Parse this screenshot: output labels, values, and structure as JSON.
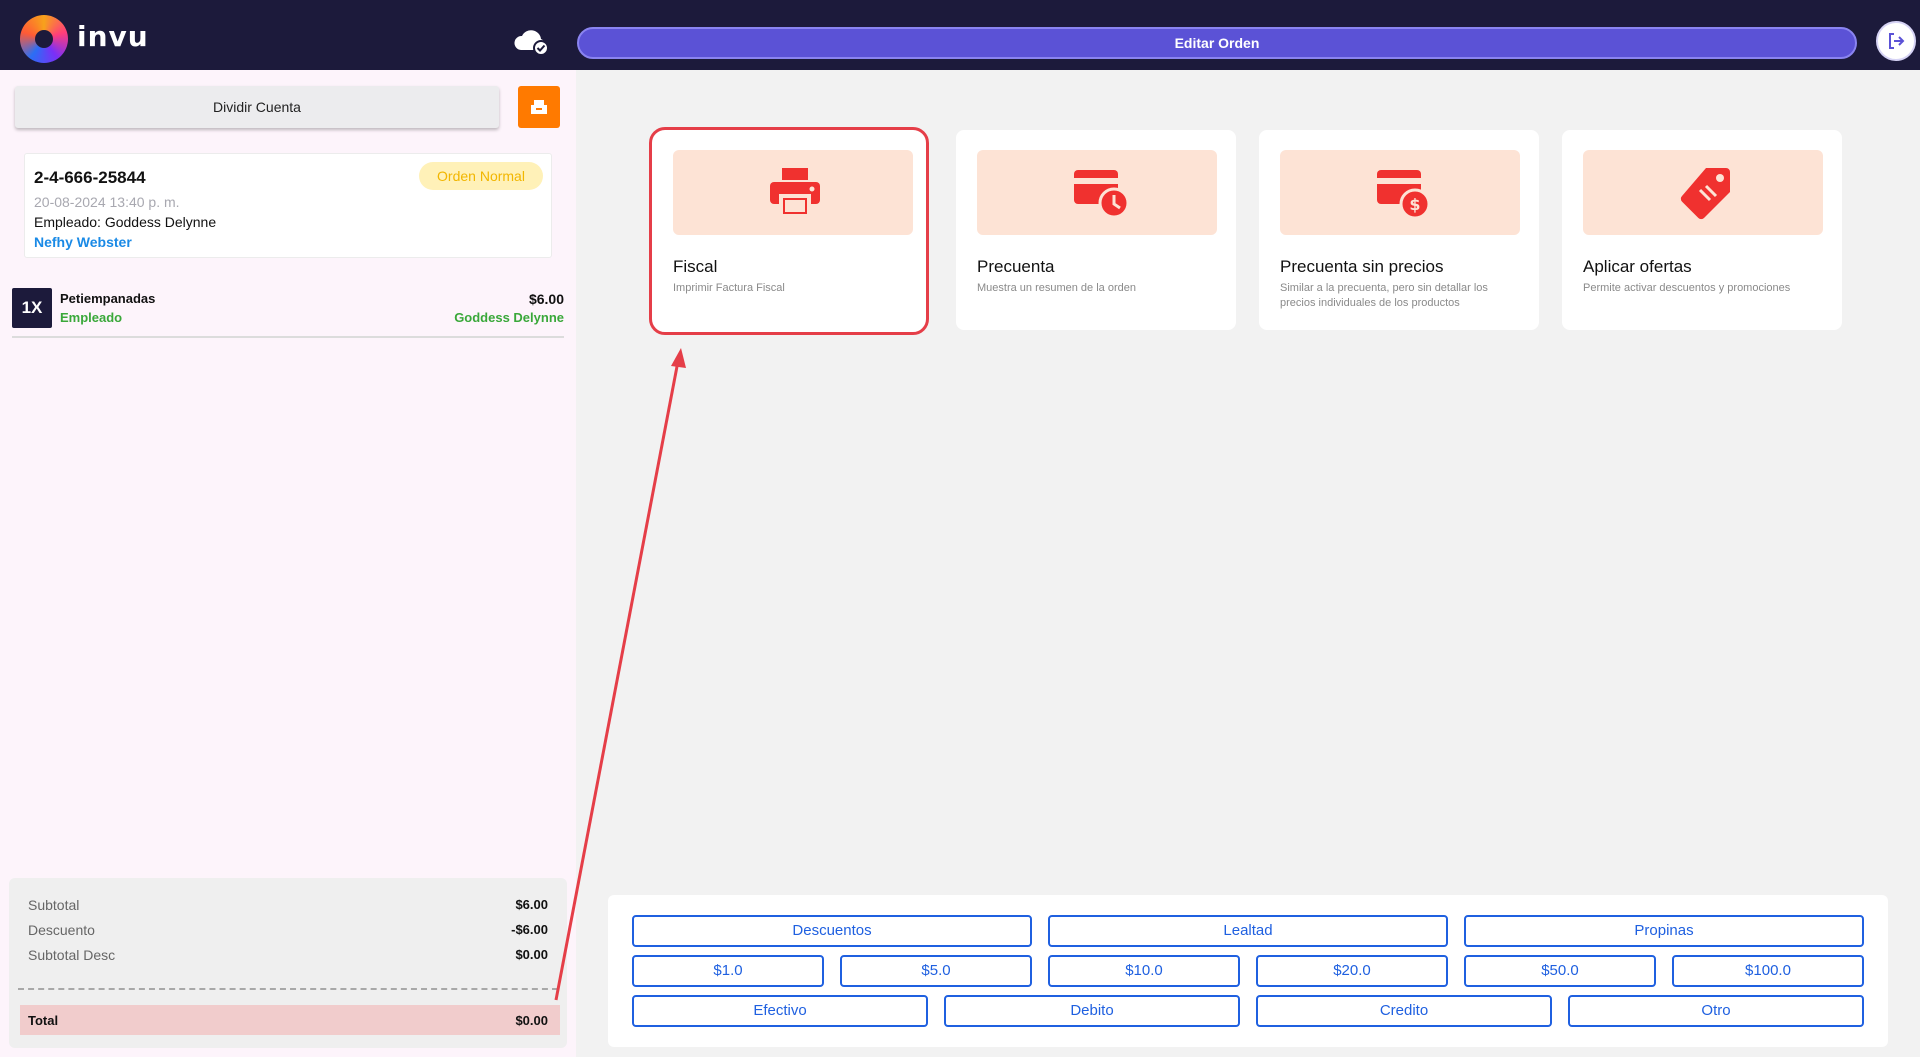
{
  "header": {
    "brand": "invu",
    "edit_order_label": "Editar Orden"
  },
  "left": {
    "split_label": "Dividir Cuenta",
    "order": {
      "id": "2-4-666-25844",
      "type": "Orden Normal",
      "date": "20-08-2024 13:40 p. m.",
      "employee_label": "Empleado:",
      "employee_name": "Goddess Delynne",
      "client": "Nefhy Webster"
    },
    "items": [
      {
        "qty": "1X",
        "name": "Petiempanadas",
        "sub": "Empleado",
        "price": "$6.00",
        "employee": "Goddess Delynne"
      }
    ],
    "totals": {
      "subtotal_label": "Subtotal",
      "subtotal": "$6.00",
      "discount_label": "Descuento",
      "discount": "-$6.00",
      "subtotal_desc_label": "Subtotal Desc",
      "subtotal_desc": "$0.00",
      "total_label": "Total",
      "total": "$0.00"
    }
  },
  "options": [
    {
      "title": "Fiscal",
      "desc": "Imprimir Factura Fiscal",
      "icon": "printer-icon"
    },
    {
      "title": "Precuenta",
      "desc": "Muestra un resumen de la orden",
      "icon": "card-clock-icon"
    },
    {
      "title": "Precuenta sin precios",
      "desc": "Similar a la precuenta, pero sin detallar los precios individuales de los productos",
      "icon": "card-dollar-icon"
    },
    {
      "title": "Aplicar ofertas",
      "desc": "Permite activar descuentos y promociones",
      "icon": "tag-icon"
    }
  ],
  "payment": {
    "row1": [
      "Descuentos",
      "Lealtad",
      "Propinas"
    ],
    "amounts": [
      "$1.0",
      "$5.0",
      "$10.0",
      "$20.0",
      "$50.0",
      "$100.0"
    ],
    "methods": [
      "Efectivo",
      "Debito",
      "Credito",
      "Otro"
    ]
  },
  "colors": {
    "header_bg": "#1c1a3b",
    "accent": "#5b52d6",
    "orange": "#ff7a00",
    "highlight": "#e53e48",
    "pay_blue": "#1f60e0"
  }
}
